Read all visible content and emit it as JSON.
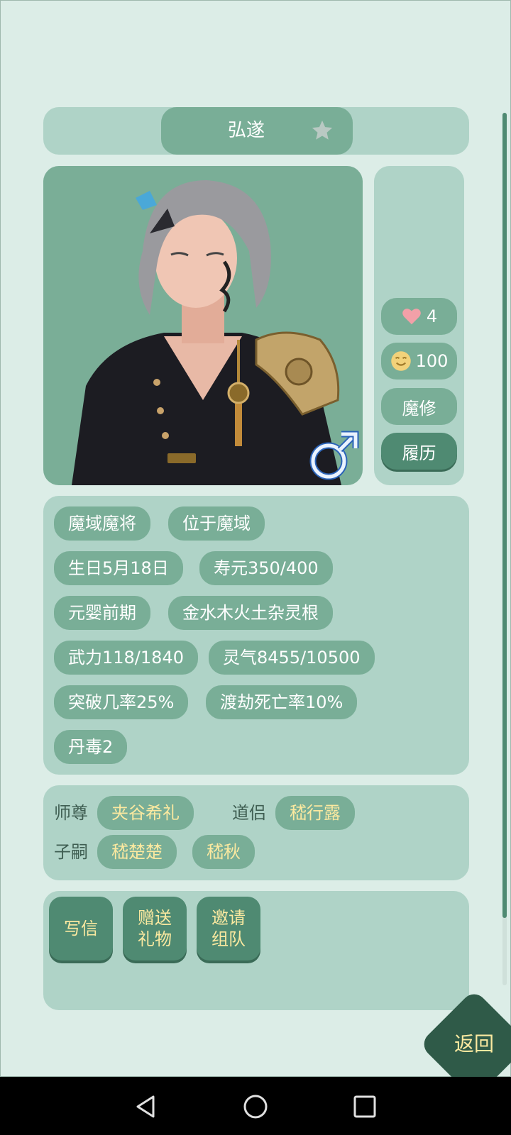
{
  "character": {
    "name": "弘遂",
    "favor": "4",
    "mood": "100",
    "school": "魔修",
    "history_button": "履历"
  },
  "stats": {
    "tags": [
      "魔域魔将",
      "位于魔域",
      "生日5月18日",
      "寿元350/400",
      "元婴前期",
      "金水木火土杂灵根",
      "武力118/1840",
      "灵气8455/10500",
      "突破几率25%",
      "渡劫死亡率10%",
      "丹毒2"
    ]
  },
  "relations": {
    "master_label": "师尊",
    "master": "夹谷希礼",
    "partner_label": "道侣",
    "partner": "嵇行露",
    "children_label": "子嗣",
    "children": [
      "嵇楚楚",
      "嵇秋"
    ]
  },
  "actions": {
    "write_letter": "写信",
    "send_gift": "赠送\n礼物",
    "invite_team": "邀请\n组队"
  },
  "back_label": "返回",
  "colors": {
    "background": "#dcede7",
    "panel": "#afd3c7",
    "pill": "#79ae97",
    "dark_button": "#4f8a72",
    "gold_text": "#fbe9a0"
  },
  "icons": {
    "favorite": "star-icon",
    "gender": "male-icon",
    "favor": "heart-icon",
    "mood": "smile-icon"
  }
}
